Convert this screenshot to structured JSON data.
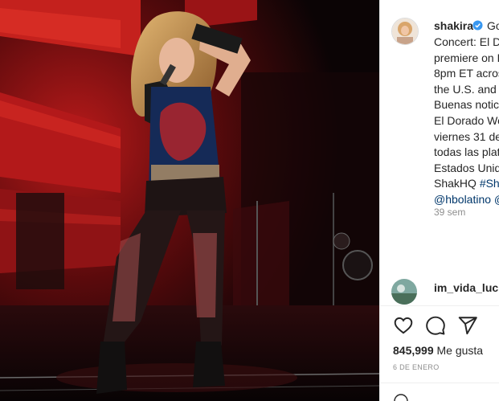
{
  "post": {
    "username": "shakira",
    "follow_fragment": "Go",
    "caption_lines": [
      "Concert: El Do",
      "premiere on F",
      "8pm ET acros",
      "the U.S. and L",
      "Buenas noticia",
      "El Dorado Wo",
      "viernes 31 de",
      "todas las plat",
      "Estados Unido"
    ],
    "caption_link_line_prefix": "ShakHQ ",
    "caption_link_line_tag": "#Sha",
    "caption_mention": "@hbolatino @",
    "time_ago": "39 sem",
    "commenter_username": "im_vida_lucia",
    "likes_count": "845,999",
    "likes_unit": "Me gusta",
    "date": "6 DE ENERO"
  },
  "icons": {
    "like": "heart-icon",
    "comment": "comment-icon",
    "share": "share-icon",
    "verified": "verified-badge-icon"
  },
  "colors": {
    "link": "#00376b",
    "verified": "#3897f0",
    "text": "#262626",
    "muted": "#8e8e8e"
  }
}
